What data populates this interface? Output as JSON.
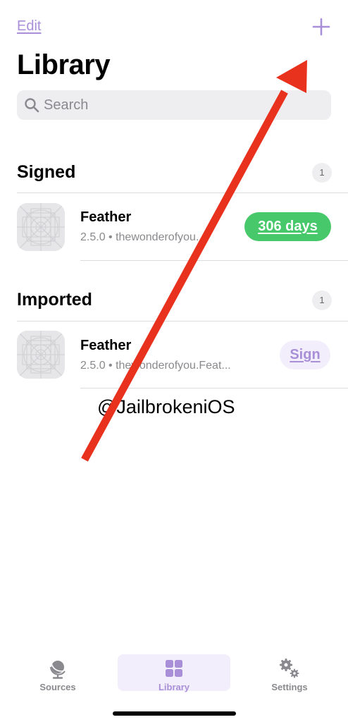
{
  "header": {
    "edit_label": "Edit",
    "add_icon": "plus-icon",
    "title": "Library"
  },
  "search": {
    "placeholder": "Search",
    "icon": "magnifier-icon"
  },
  "sections": [
    {
      "title": "Signed",
      "count": "1",
      "apps": [
        {
          "name": "Feather",
          "subtitle": "2.5.0 • thewonderofyou...",
          "action_label": "306 days",
          "action_color": "#47c86a"
        }
      ]
    },
    {
      "title": "Imported",
      "count": "1",
      "apps": [
        {
          "name": "Feather",
          "subtitle": "2.5.0 • thewonderofyou.Feat...",
          "action_label": "Sign",
          "action_color": "#a98fd8"
        }
      ]
    }
  ],
  "watermark": "@JailbrokeniOS",
  "tabbar": {
    "tabs": [
      {
        "label": "Sources",
        "icon": "globe-icon",
        "active": false
      },
      {
        "label": "Library",
        "icon": "grid-icon",
        "active": true
      },
      {
        "label": "Settings",
        "icon": "gears-icon",
        "active": false
      }
    ]
  },
  "colors": {
    "accent": "#a98fd8",
    "success": "#47c86a",
    "arrow": "#e8321e"
  }
}
